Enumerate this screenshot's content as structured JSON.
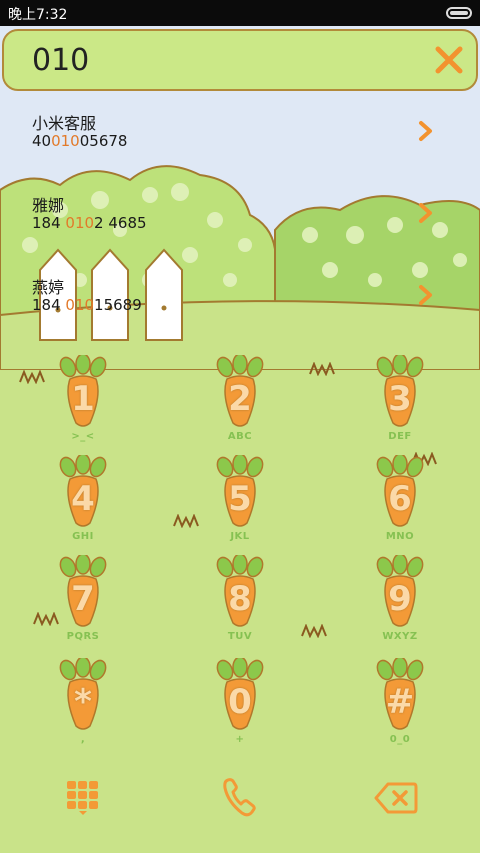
{
  "status": {
    "time": "晚上7:32"
  },
  "search": {
    "query": "010"
  },
  "results": [
    {
      "name": "小米客服",
      "number_pre": "40",
      "number_hl": "010",
      "number_post": "05678"
    },
    {
      "name": "雅娜",
      "number_pre": "184 ",
      "number_hl": "010",
      "number_post": "2 4685"
    },
    {
      "name": "燕婷",
      "number_pre": "184 ",
      "number_hl": "010",
      "number_post": "15689"
    }
  ],
  "keypad": {
    "keys": [
      {
        "digit": "1",
        "letters": ">_<"
      },
      {
        "digit": "2",
        "letters": "ABC"
      },
      {
        "digit": "3",
        "letters": "DEF"
      },
      {
        "digit": "4",
        "letters": "GHI"
      },
      {
        "digit": "5",
        "letters": "JKL"
      },
      {
        "digit": "6",
        "letters": "MNO"
      },
      {
        "digit": "7",
        "letters": "PQRS"
      },
      {
        "digit": "8",
        "letters": "TUV"
      },
      {
        "digit": "9",
        "letters": "WXYZ"
      },
      {
        "digit": "*",
        "letters": ","
      },
      {
        "digit": "0",
        "letters": "+"
      },
      {
        "digit": "#",
        "letters": "0_0"
      }
    ]
  },
  "toolbar": {
    "keypad_icon": "grid-icon",
    "call_icon": "phone-icon",
    "delete_icon": "backspace-icon"
  },
  "colors": {
    "carrot": "#f39a37",
    "leaves": "#8cc84b",
    "outline": "#b0782b",
    "ground": "#c9e389",
    "highlight": "#e27a2a"
  }
}
